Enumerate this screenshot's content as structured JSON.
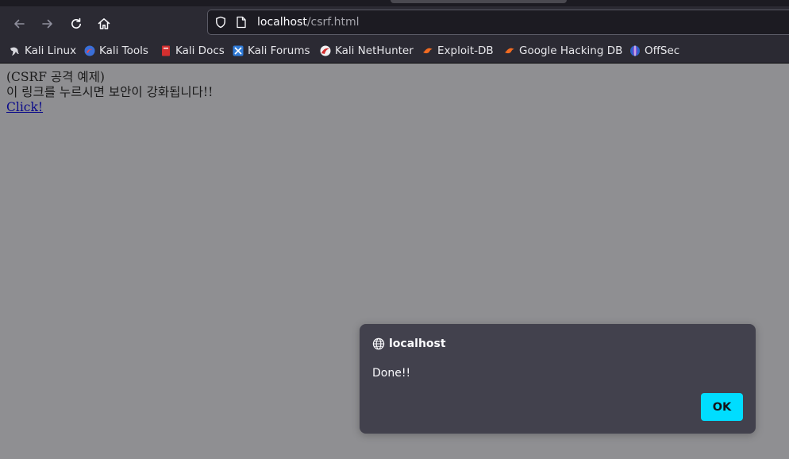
{
  "browser": {
    "url_host": "localhost",
    "url_path": "/csrf.html",
    "bookmarks": [
      {
        "label": "Kali Linux",
        "icon": "kali-dragon-icon"
      },
      {
        "label": "Kali Tools",
        "icon": "kali-tools-icon"
      },
      {
        "label": "Kali Docs",
        "icon": "kali-docs-icon"
      },
      {
        "label": "Kali Forums",
        "icon": "kali-forums-icon"
      },
      {
        "label": "Kali NetHunter",
        "icon": "nethunter-icon"
      },
      {
        "label": "Exploit-DB",
        "icon": "exploit-db-icon"
      },
      {
        "label": "Google Hacking DB",
        "icon": "ghdb-icon"
      },
      {
        "label": "OffSec",
        "icon": "offsec-icon"
      }
    ]
  },
  "page": {
    "line1": "(CSRF 공격 예제)",
    "line2": "이 링크를 누르시면 보안이 강화됩니다!!",
    "link": "Click!"
  },
  "dialog": {
    "origin": "localhost",
    "message": "Done!!",
    "ok_label": "OK"
  },
  "colors": {
    "chrome_bg": "#2b2a33",
    "page_dimmed_bg": "#8f8f92",
    "dialog_bg": "#42414d",
    "accent": "#00ddff"
  }
}
